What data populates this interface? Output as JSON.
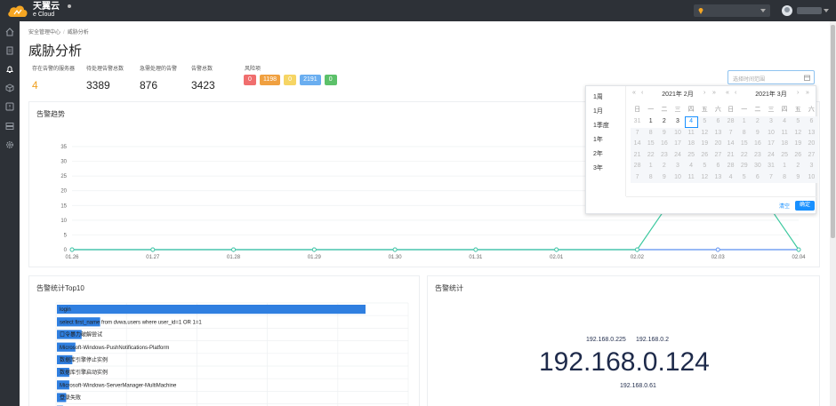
{
  "brand": {
    "name_cn": "天翼云",
    "name_en": "e Cloud"
  },
  "sidebar": {
    "icons": [
      "home-icon",
      "doc-icon",
      "bell-icon",
      "cube-icon",
      "alert-icon",
      "server-icon",
      "gear-icon"
    ]
  },
  "breadcrumb": [
    "安全管理中心",
    "威胁分析"
  ],
  "page_title": "威胁分析",
  "stats": [
    {
      "label": "存在告警的服务器",
      "value": "4"
    },
    {
      "label": "待处理告警总数",
      "value": "3389"
    },
    {
      "label": "急需处理的告警",
      "value": "876"
    },
    {
      "label": "告警总数",
      "value": "3423"
    }
  ],
  "risk": {
    "label": "风险项",
    "badges": [
      {
        "value": "0",
        "color": "#f06e6e"
      },
      {
        "value": "1198",
        "color": "#f0a040"
      },
      {
        "value": "0",
        "color": "#f6d564"
      },
      {
        "value": "2191",
        "color": "#6aaef0"
      },
      {
        "value": "0",
        "color": "#5cc16a"
      }
    ]
  },
  "date_picker": {
    "placeholder": "选择时间范围",
    "shortcuts": [
      "1周",
      "1月",
      "1季度",
      "1年",
      "2年",
      "3年"
    ],
    "weekdays": [
      "日",
      "一",
      "二",
      "三",
      "四",
      "五",
      "六"
    ],
    "left_month": {
      "title": "2021年 2月",
      "days": [
        "31",
        "1",
        "2",
        "3",
        "4",
        "5",
        "6",
        "7",
        "8",
        "9",
        "10",
        "11",
        "12",
        "13",
        "14",
        "15",
        "16",
        "17",
        "18",
        "19",
        "20",
        "21",
        "22",
        "23",
        "24",
        "25",
        "26",
        "27",
        "28",
        "1",
        "2",
        "3",
        "4",
        "5",
        "6",
        "7",
        "8",
        "9",
        "10",
        "11",
        "12",
        "13"
      ],
      "enabled_count": 4,
      "today_index": 4
    },
    "right_month": {
      "title": "2021年 3月",
      "days": [
        "28",
        "1",
        "2",
        "3",
        "4",
        "5",
        "6",
        "7",
        "8",
        "9",
        "10",
        "11",
        "12",
        "13",
        "14",
        "15",
        "16",
        "17",
        "18",
        "19",
        "20",
        "21",
        "22",
        "23",
        "24",
        "25",
        "26",
        "27",
        "28",
        "29",
        "30",
        "31",
        "1",
        "2",
        "3",
        "4",
        "5",
        "6",
        "7",
        "8",
        "9",
        "10"
      ]
    },
    "clear_label": "清空",
    "confirm_label": "确定"
  },
  "alarm_trend": {
    "title": "告警趋势",
    "chart_data": {
      "type": "line",
      "x": [
        "01.26",
        "01.27",
        "01.28",
        "01.29",
        "01.30",
        "01.31",
        "02.01",
        "02.02",
        "02.03",
        "02.04"
      ],
      "y_ticks": [
        0,
        5,
        10,
        15,
        20,
        25,
        30,
        35
      ],
      "ylim": [
        0,
        35
      ],
      "series": [
        {
          "color": "#3ec9a0",
          "values": [
            0,
            0,
            0,
            0,
            0,
            0,
            0,
            0,
            40,
            0
          ]
        },
        {
          "color": "#5b8ff0",
          "values": [
            0,
            0,
            0,
            0,
            0,
            0,
            0,
            0,
            0,
            0
          ]
        }
      ]
    }
  },
  "top10": {
    "title": "告警统计Top10",
    "chart_data": {
      "type": "bar",
      "categories": [
        "login",
        "select first_name from dvwa.users where user_id=1 OR 1=1",
        "口令暴力破解尝试",
        "Microsoft-Windows-PushNotifications-Platform",
        "数据库引擎停止实例",
        "数据库引擎启动实例",
        "Microsoft-Windows-ServerManager-MultiMachine",
        "登录失败",
        "数据库进程访问失败"
      ],
      "values": [
        100,
        14,
        8,
        6,
        5,
        4,
        4,
        3,
        2
      ],
      "xlim": [
        0,
        100
      ]
    }
  },
  "alarm_stats": {
    "title": "告警统计",
    "ips": [
      "192.168.0.124",
      "192.168.0.225",
      "192.168.0.2",
      "192.168.0.61"
    ]
  }
}
